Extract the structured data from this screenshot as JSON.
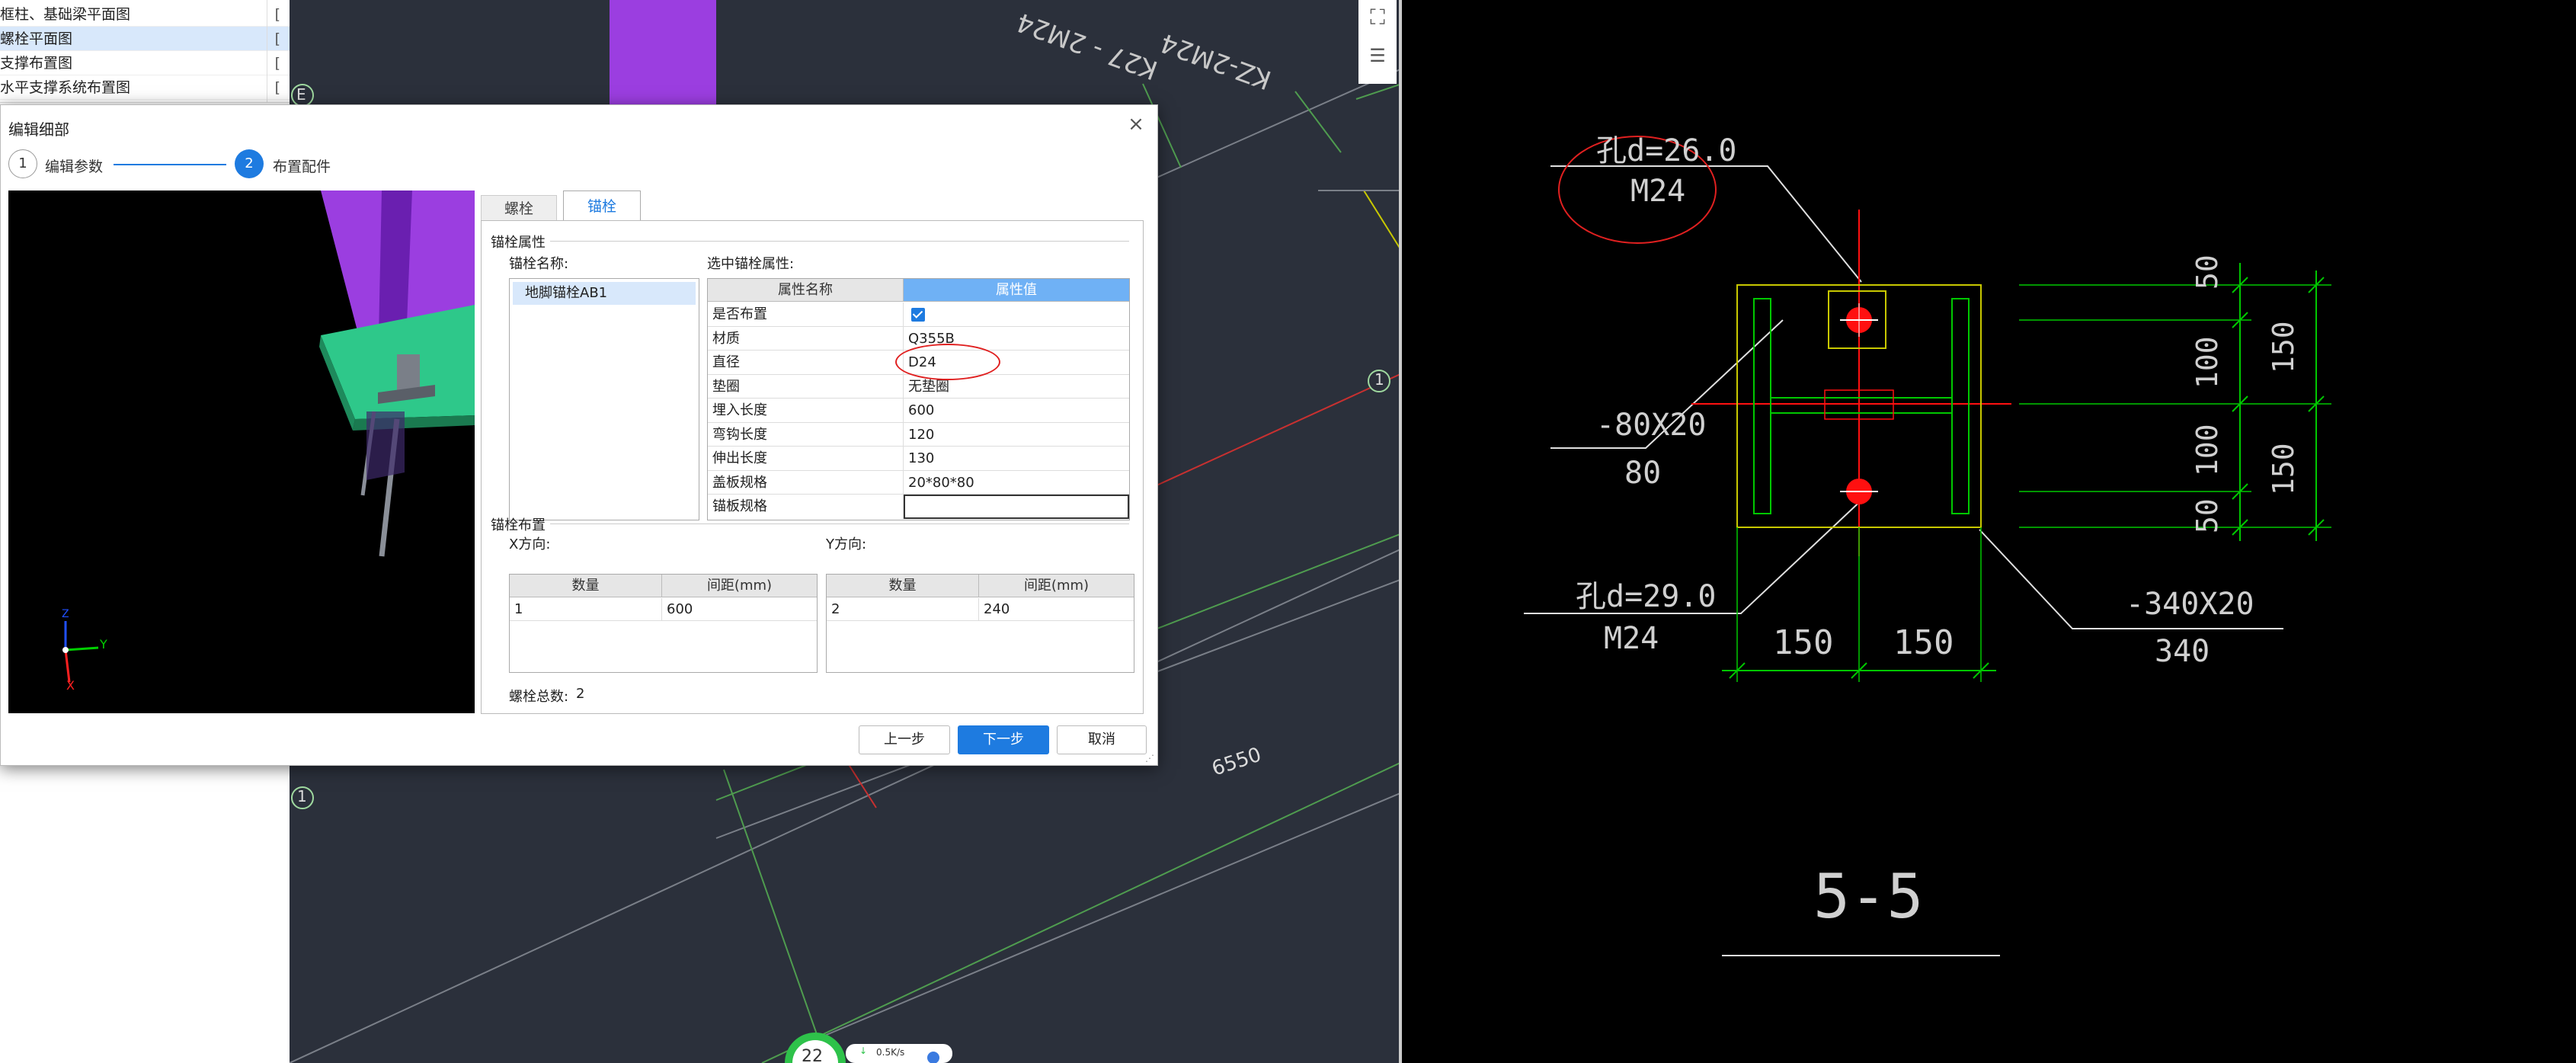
{
  "drawing_list": {
    "items": [
      {
        "label": "框柱、基础梁平面图",
        "flag": "["
      },
      {
        "label": "螺栓平面图",
        "flag": "[",
        "selected": true
      },
      {
        "label": "支撑布置图",
        "flag": "["
      },
      {
        "label": "水平支撑系统布置图",
        "flag": "["
      }
    ]
  },
  "viewport": {
    "labels": {
      "axis_1_mid": "1",
      "axis_1_low": "1",
      "axis_e": "E",
      "dim_6550": "6550",
      "rot_kz": "KZ-2M24",
      "rot_kz2": "K27 - 2M24"
    },
    "net_widget": {
      "count": "22",
      "speed": "0.5K/s",
      "arrow": "↓"
    }
  },
  "dialog": {
    "title": "编辑细部",
    "close": "×",
    "steps": [
      {
        "num": "1",
        "label": "编辑参数"
      },
      {
        "num": "2",
        "label": "布置配件"
      }
    ],
    "preview_axes": {
      "y": "Y",
      "x": "X",
      "z": "Z"
    },
    "tabs": [
      {
        "label": "螺栓"
      },
      {
        "label": "锚栓",
        "active": true
      }
    ],
    "anchor_props": {
      "group_title": "锚栓属性",
      "name_label": "锚栓名称:",
      "names": [
        "地脚锚栓AB1"
      ],
      "selected_label": "选中锚栓属性:",
      "header_name": "属性名称",
      "header_value": "属性值",
      "rows": [
        {
          "name": "是否布置",
          "value": "",
          "checkbox": true
        },
        {
          "name": "材质",
          "value": "Q355B"
        },
        {
          "name": "直径",
          "value": "D24"
        },
        {
          "name": "垫圈",
          "value": "无垫圈"
        },
        {
          "name": "埋入长度",
          "value": "600"
        },
        {
          "name": "弯钩长度",
          "value": "120"
        },
        {
          "name": "伸出长度",
          "value": "130"
        },
        {
          "name": "盖板规格",
          "value": "20*80*80"
        },
        {
          "name": "锚板规格",
          "value": "",
          "editing": true
        }
      ]
    },
    "anchor_layout": {
      "group_title": "锚栓布置",
      "x_label": "X方向:",
      "y_label": "Y方向:",
      "col_count": "数量",
      "col_spacing": "间距(mm)",
      "x_row": {
        "count": "1",
        "spacing": "600"
      },
      "y_row": {
        "count": "2",
        "spacing": "240"
      },
      "total_label": "螺栓总数:",
      "total_value": "2"
    },
    "buttons": {
      "prev": "上一步",
      "next": "下一步",
      "cancel": "取消"
    }
  },
  "cad": {
    "hole_top": "孔d=26.0",
    "bolt_top": "M24",
    "plate_left": "-80X20",
    "plate_left_sub": "80",
    "hole_bottom": "孔d=29.0",
    "bolt_bottom": "M24",
    "plate_right": "-340X20",
    "plate_right_sub": "340",
    "dim_150_a": "150",
    "dim_150_b": "150",
    "dim_right": [
      "50",
      "100",
      "100",
      "50"
    ],
    "dim_right_outer": [
      "150",
      "150"
    ],
    "section": "5-5"
  },
  "colors": {
    "accent": "#1e7be0",
    "cad_green": "#00c800",
    "cad_yellow": "#c8c800",
    "cad_red": "#ff1010",
    "column_purple": "#9b3ee0"
  }
}
